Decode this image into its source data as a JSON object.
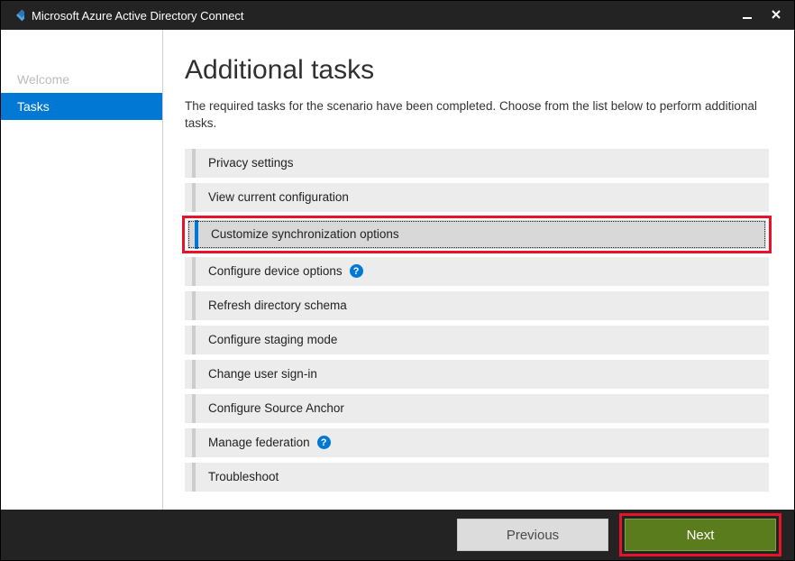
{
  "window": {
    "title": "Microsoft Azure Active Directory Connect"
  },
  "sidebar": {
    "items": [
      {
        "label": "Welcome",
        "active": false
      },
      {
        "label": "Tasks",
        "active": true
      }
    ]
  },
  "main": {
    "heading": "Additional tasks",
    "description": "The required tasks for the scenario have been completed. Choose from the list below to perform additional tasks.",
    "tasks": [
      {
        "label": "Privacy settings",
        "help": false,
        "selected": false,
        "highlight": false
      },
      {
        "label": "View current configuration",
        "help": false,
        "selected": false,
        "highlight": false
      },
      {
        "label": "Customize synchronization options",
        "help": false,
        "selected": true,
        "highlight": true
      },
      {
        "label": "Configure device options",
        "help": true,
        "selected": false,
        "highlight": false
      },
      {
        "label": "Refresh directory schema",
        "help": false,
        "selected": false,
        "highlight": false
      },
      {
        "label": "Configure staging mode",
        "help": false,
        "selected": false,
        "highlight": false
      },
      {
        "label": "Change user sign-in",
        "help": false,
        "selected": false,
        "highlight": false
      },
      {
        "label": "Configure Source Anchor",
        "help": false,
        "selected": false,
        "highlight": false
      },
      {
        "label": "Manage federation",
        "help": true,
        "selected": false,
        "highlight": false
      },
      {
        "label": "Troubleshoot",
        "help": false,
        "selected": false,
        "highlight": false
      }
    ]
  },
  "footer": {
    "previous": "Previous",
    "next": "Next"
  },
  "colors": {
    "accent": "#0078d4",
    "highlight": "#e8132a",
    "next_btn": "#5b7c1d"
  }
}
